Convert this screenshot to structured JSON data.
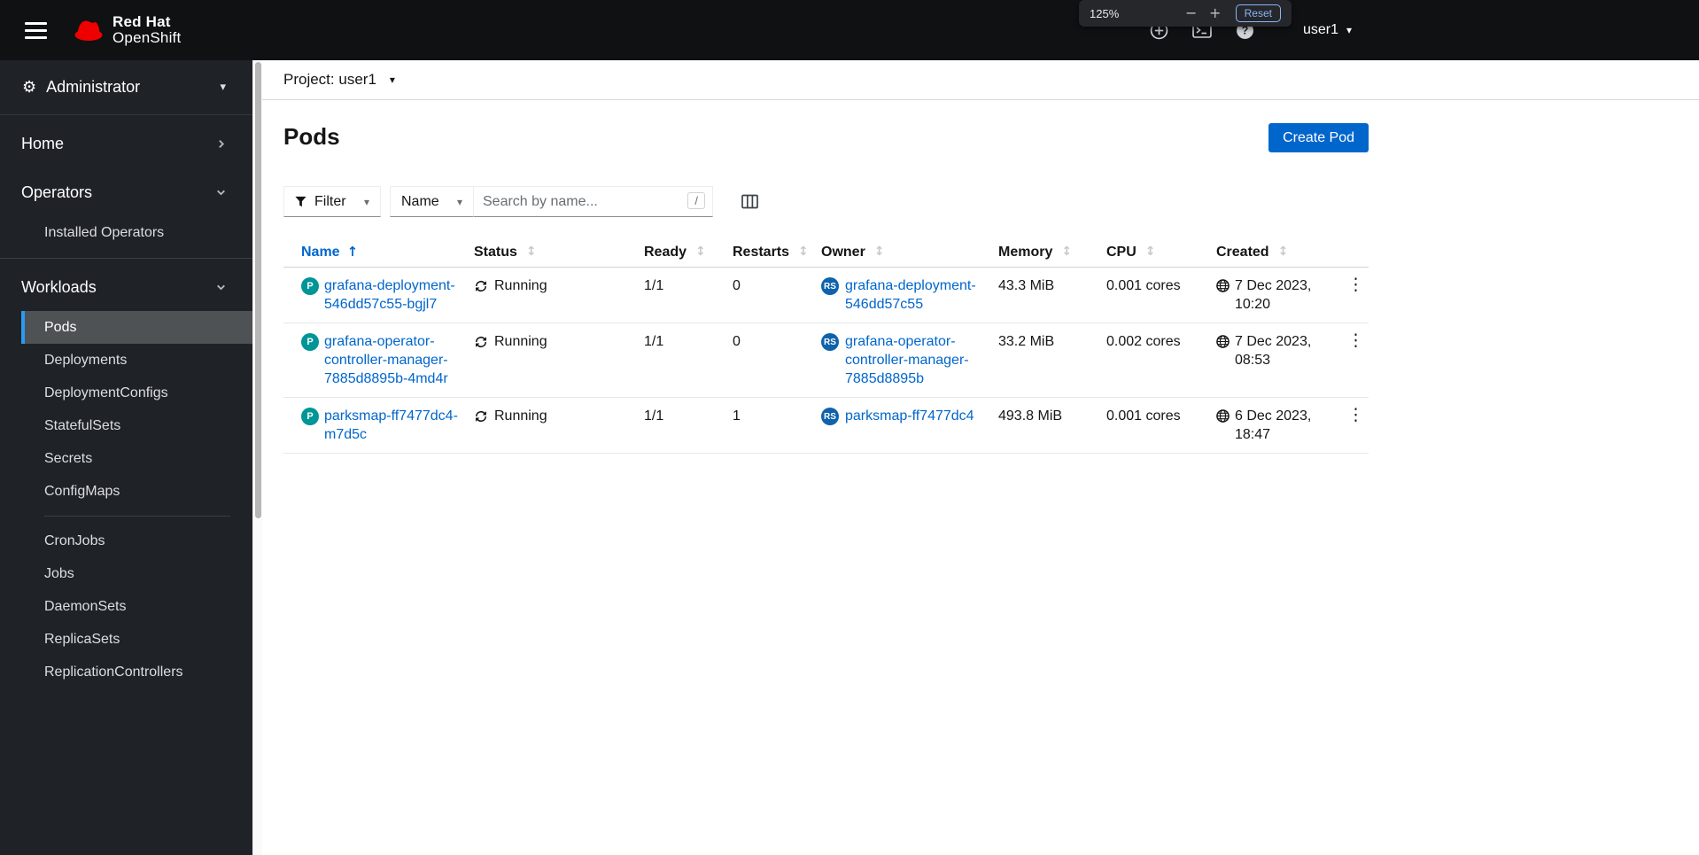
{
  "masthead": {
    "brand": {
      "line1": "Red Hat",
      "line2": "OpenShift"
    },
    "user_menu": "user1"
  },
  "zoom_overlay": {
    "level": "125%",
    "reset": "Reset"
  },
  "icons": {
    "caret_down": "▾",
    "gear": "⚙",
    "sort_both": "↕",
    "sort_asc": "↑",
    "kebab": "⋮",
    "minus": "−",
    "plus": "+",
    "help": "?"
  },
  "sidebar": {
    "perspective": {
      "label": "Administrator"
    },
    "home": {
      "label": "Home"
    },
    "operators": {
      "label": "Operators",
      "items": [
        {
          "label": "Installed Operators"
        }
      ]
    },
    "workloads": {
      "label": "Workloads",
      "items": [
        {
          "label": "Pods"
        },
        {
          "label": "Deployments"
        },
        {
          "label": "DeploymentConfigs"
        },
        {
          "label": "StatefulSets"
        },
        {
          "label": "Secrets"
        },
        {
          "label": "ConfigMaps"
        },
        {
          "label": "CronJobs"
        },
        {
          "label": "Jobs"
        },
        {
          "label": "DaemonSets"
        },
        {
          "label": "ReplicaSets"
        },
        {
          "label": "ReplicationControllers"
        }
      ]
    }
  },
  "project_bar": {
    "label": "Project:",
    "value": "user1"
  },
  "page": {
    "title": "Pods",
    "create_button": "Create Pod"
  },
  "toolbar": {
    "filter": "Filter",
    "attribute": "Name",
    "search_placeholder": "Search by name...",
    "search_shortcut": "/"
  },
  "table": {
    "columns": {
      "name": "Name",
      "status": "Status",
      "ready": "Ready",
      "restarts": "Restarts",
      "owner": "Owner",
      "memory": "Memory",
      "cpu": "CPU",
      "created": "Created"
    },
    "badges": {
      "pod": "P",
      "replicaset": "RS"
    },
    "rows": [
      {
        "name": "grafana-deployment-546dd57c55-bgjl7",
        "status": "Running",
        "ready": "1/1",
        "restarts": "0",
        "owner": "grafana-deployment-546dd57c55",
        "memory": "43.3 MiB",
        "cpu": "0.001 cores",
        "created": "7 Dec 2023, 10:20"
      },
      {
        "name": "grafana-operator-controller-manager-7885d8895b-4md4r",
        "status": "Running",
        "ready": "1/1",
        "restarts": "0",
        "owner": "grafana-operator-controller-manager-7885d8895b",
        "memory": "33.2 MiB",
        "cpu": "0.002 cores",
        "created": "7 Dec 2023, 08:53"
      },
      {
        "name": "parksmap-ff7477dc4-m7d5c",
        "status": "Running",
        "ready": "1/1",
        "restarts": "1",
        "owner": "parksmap-ff7477dc4",
        "memory": "493.8 MiB",
        "cpu": "0.001 cores",
        "created": "6 Dec 2023, 18:47"
      }
    ]
  },
  "colors": {
    "accent": "#0066cc",
    "brand_red": "#ee0000",
    "pod_badge": "#009596",
    "replicaset_badge": "#0f62ab",
    "nav_active_border": "#2b9af3"
  }
}
